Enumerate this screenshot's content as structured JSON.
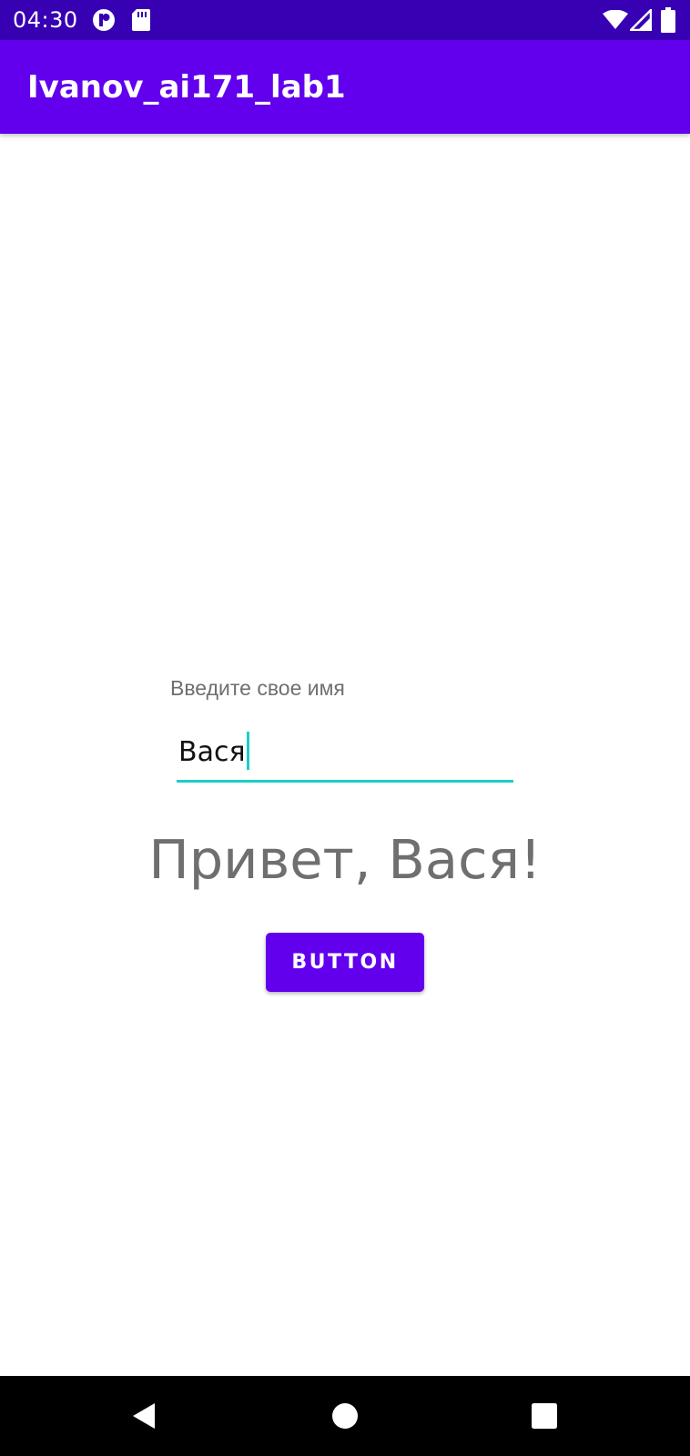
{
  "status_bar": {
    "time": "04:30",
    "left_icons": [
      "app-notification-icon",
      "sd-card-icon"
    ],
    "right_icons": [
      "wifi-icon",
      "cellular-signal-icon",
      "battery-icon"
    ]
  },
  "app_bar": {
    "title": "Ivanov_ai171_lab1"
  },
  "form": {
    "label": "Введите свое имя",
    "input_value": "Вася",
    "greeting": "Привет, Вася!",
    "button_label": "BUTTON"
  },
  "navigation_bar": {
    "buttons": [
      "back-icon",
      "home-icon",
      "recents-icon"
    ]
  },
  "colors": {
    "status_bar": "#3700B3",
    "primary": "#6200EE",
    "accent": "#1ACFC4",
    "label_text": "#6F6F6F"
  }
}
